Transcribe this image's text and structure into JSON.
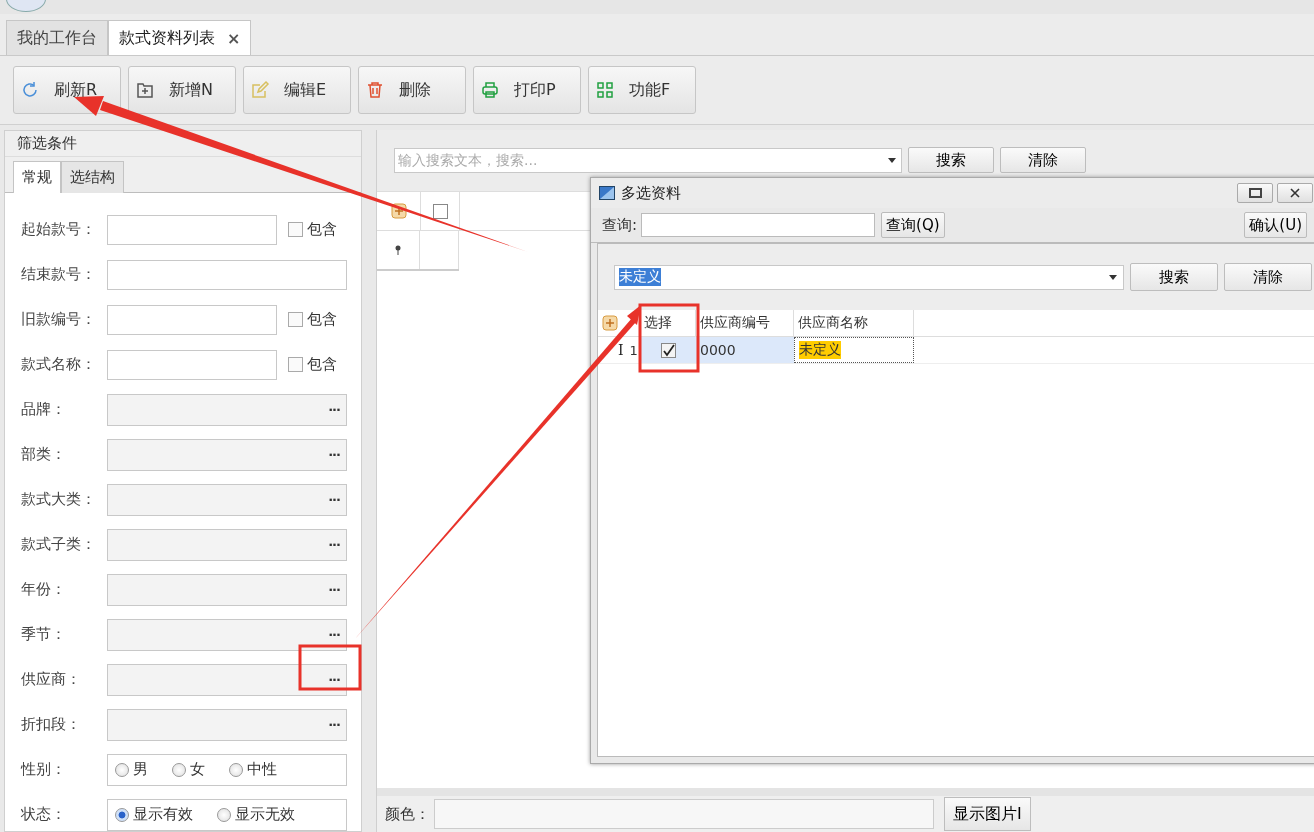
{
  "tabs": [
    {
      "label": "我的工作台",
      "selected": false,
      "closable": false
    },
    {
      "label": "款式资料列表",
      "selected": true,
      "closable": true
    }
  ],
  "close_glyph": "×",
  "toolbar": [
    {
      "label": "刷新R",
      "kind": "refresh"
    },
    {
      "label": "新增N",
      "kind": "add"
    },
    {
      "label": "编辑E",
      "kind": "edit"
    },
    {
      "label": "删除",
      "kind": "delete"
    },
    {
      "label": "打印P",
      "kind": "print"
    },
    {
      "label": "功能F",
      "kind": "function"
    }
  ],
  "filter_panel": {
    "title": "筛选条件",
    "tabs": [
      {
        "label": "常规",
        "selected": true
      },
      {
        "label": "选结构",
        "selected": false
      }
    ],
    "fields": [
      {
        "label": "起始款号：",
        "kind": "text",
        "include": {
          "label": "包含",
          "checked": false
        }
      },
      {
        "label": "结束款号：",
        "kind": "text"
      },
      {
        "label": "旧款编号：",
        "kind": "text",
        "include": {
          "label": "包含",
          "checked": false
        }
      },
      {
        "label": "款式名称：",
        "kind": "text",
        "include": {
          "label": "包含",
          "checked": false
        }
      },
      {
        "label": "品牌：",
        "kind": "lookup",
        "ellipsis": "···"
      },
      {
        "label": "部类：",
        "kind": "lookup",
        "ellipsis": "···"
      },
      {
        "label": "款式大类：",
        "kind": "lookup",
        "ellipsis": "···"
      },
      {
        "label": "款式子类：",
        "kind": "lookup",
        "ellipsis": "···"
      },
      {
        "label": "年份：",
        "kind": "lookup",
        "ellipsis": "···"
      },
      {
        "label": "季节：",
        "kind": "lookup",
        "ellipsis": "···"
      },
      {
        "label": "供应商：",
        "kind": "lookup",
        "ellipsis": "···"
      },
      {
        "label": "折扣段：",
        "kind": "lookup",
        "ellipsis": "···"
      },
      {
        "label": "性别：",
        "kind": "radio",
        "options": [
          {
            "label": "男",
            "selected": false
          },
          {
            "label": "女",
            "selected": false
          },
          {
            "label": "中性",
            "selected": false
          }
        ]
      },
      {
        "label": "状态：",
        "kind": "radio",
        "options": [
          {
            "label": "显示有效",
            "selected": true
          },
          {
            "label": "显示无效",
            "selected": false
          }
        ]
      }
    ]
  },
  "main": {
    "search": {
      "placeholder": "输入搜索文本，搜索..."
    },
    "buttons": [
      "搜索",
      "清除"
    ],
    "bottom": {
      "label": "颜色：",
      "button": "显示图片I"
    }
  },
  "dialog": {
    "title": "多选资料",
    "query_label": "查询:",
    "query_button": "查询(Q)",
    "confirm_button": "确认(U)",
    "filter_value": "未定义",
    "buttons": [
      "搜索",
      "清除"
    ],
    "columns": [
      "选择",
      "供应商编号",
      "供应商名称"
    ],
    "rows": [
      {
        "cursor": "I",
        "number": "1",
        "checked": true,
        "code": "0000",
        "name": "未定义"
      }
    ]
  }
}
